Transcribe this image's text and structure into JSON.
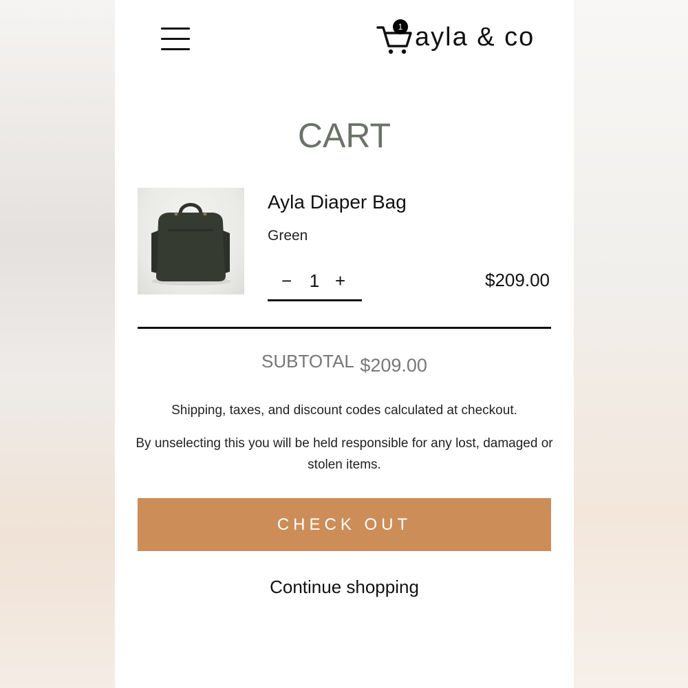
{
  "header": {
    "brand": "ayla & co",
    "cart_count": "1",
    "icons": {
      "menu": "hamburger-menu-icon",
      "cart": "shopping-cart-icon"
    }
  },
  "page": {
    "title": "CART"
  },
  "cart": {
    "items": [
      {
        "name": "Ayla Diaper Bag",
        "variant": "Green",
        "quantity": "1",
        "minus": "−",
        "plus": "+",
        "price": "$209.00"
      }
    ],
    "subtotal_label": "SUBTOTAL",
    "subtotal_value": "$209.00",
    "shipping_note": "Shipping, taxes, and discount codes calculated at checkout.",
    "responsibility_note": "By unselecting this you will be held responsible for any lost, damaged or stolen items.",
    "checkout_label": "CHECK OUT",
    "continue_label": "Continue shopping"
  },
  "colors": {
    "title": "#6b7369",
    "subtotal": "#777777",
    "checkout_button": "#cc8d58",
    "bag": "#33392f"
  }
}
